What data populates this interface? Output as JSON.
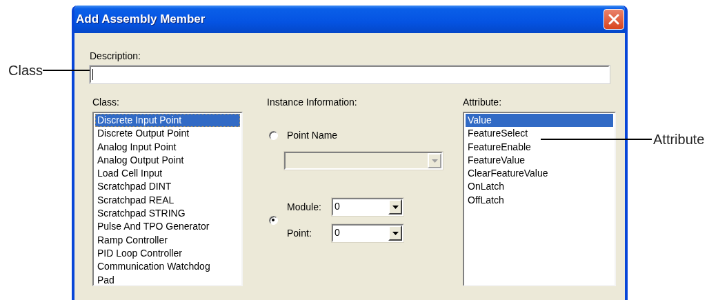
{
  "window": {
    "title": "Add Assembly Member"
  },
  "description": {
    "label": "Description:",
    "focused": true
  },
  "class_list": {
    "label": "Class:",
    "items": [
      {
        "label": "Discrete Input Point",
        "selected": true
      },
      {
        "label": "Discrete Output Point",
        "selected": false
      },
      {
        "label": "Analog Input Point",
        "selected": false
      },
      {
        "label": "Analog Output Point",
        "selected": false
      },
      {
        "label": "Load Cell Input",
        "selected": false
      },
      {
        "label": "Scratchpad DINT",
        "selected": false
      },
      {
        "label": "Scratchpad REAL",
        "selected": false
      },
      {
        "label": "Scratchpad STRING",
        "selected": false
      },
      {
        "label": "Pulse And TPO Generator",
        "selected": false
      },
      {
        "label": "Ramp Controller",
        "selected": false
      },
      {
        "label": "PID Loop Controller",
        "selected": false
      },
      {
        "label": "Communication Watchdog",
        "selected": false
      },
      {
        "label": "Pad",
        "selected": false
      }
    ]
  },
  "instance": {
    "label": "Instance Information:",
    "options": [
      {
        "kind": "named",
        "label": "Point Name",
        "selected": false,
        "combo": {
          "disabled": true
        }
      },
      {
        "kind": "fields",
        "selected": true,
        "fields": [
          {
            "label": "Module:",
            "value": "0",
            "disabled": false
          },
          {
            "label": "Point:",
            "value": "0",
            "disabled": false
          }
        ]
      }
    ]
  },
  "attribute_list": {
    "label": "Attribute:",
    "items": [
      {
        "label": "Value",
        "selected": true
      },
      {
        "label": "FeatureSelect",
        "selected": false
      },
      {
        "label": "FeatureEnable",
        "selected": false
      },
      {
        "label": "FeatureValue",
        "selected": false
      },
      {
        "label": "ClearFeatureValue",
        "selected": false
      },
      {
        "label": "OnLatch",
        "selected": false
      },
      {
        "label": "OffLatch",
        "selected": false
      }
    ]
  },
  "callouts": [
    {
      "label": "Class",
      "kind": "left"
    },
    {
      "label": "Attribute",
      "kind": "right"
    }
  ]
}
